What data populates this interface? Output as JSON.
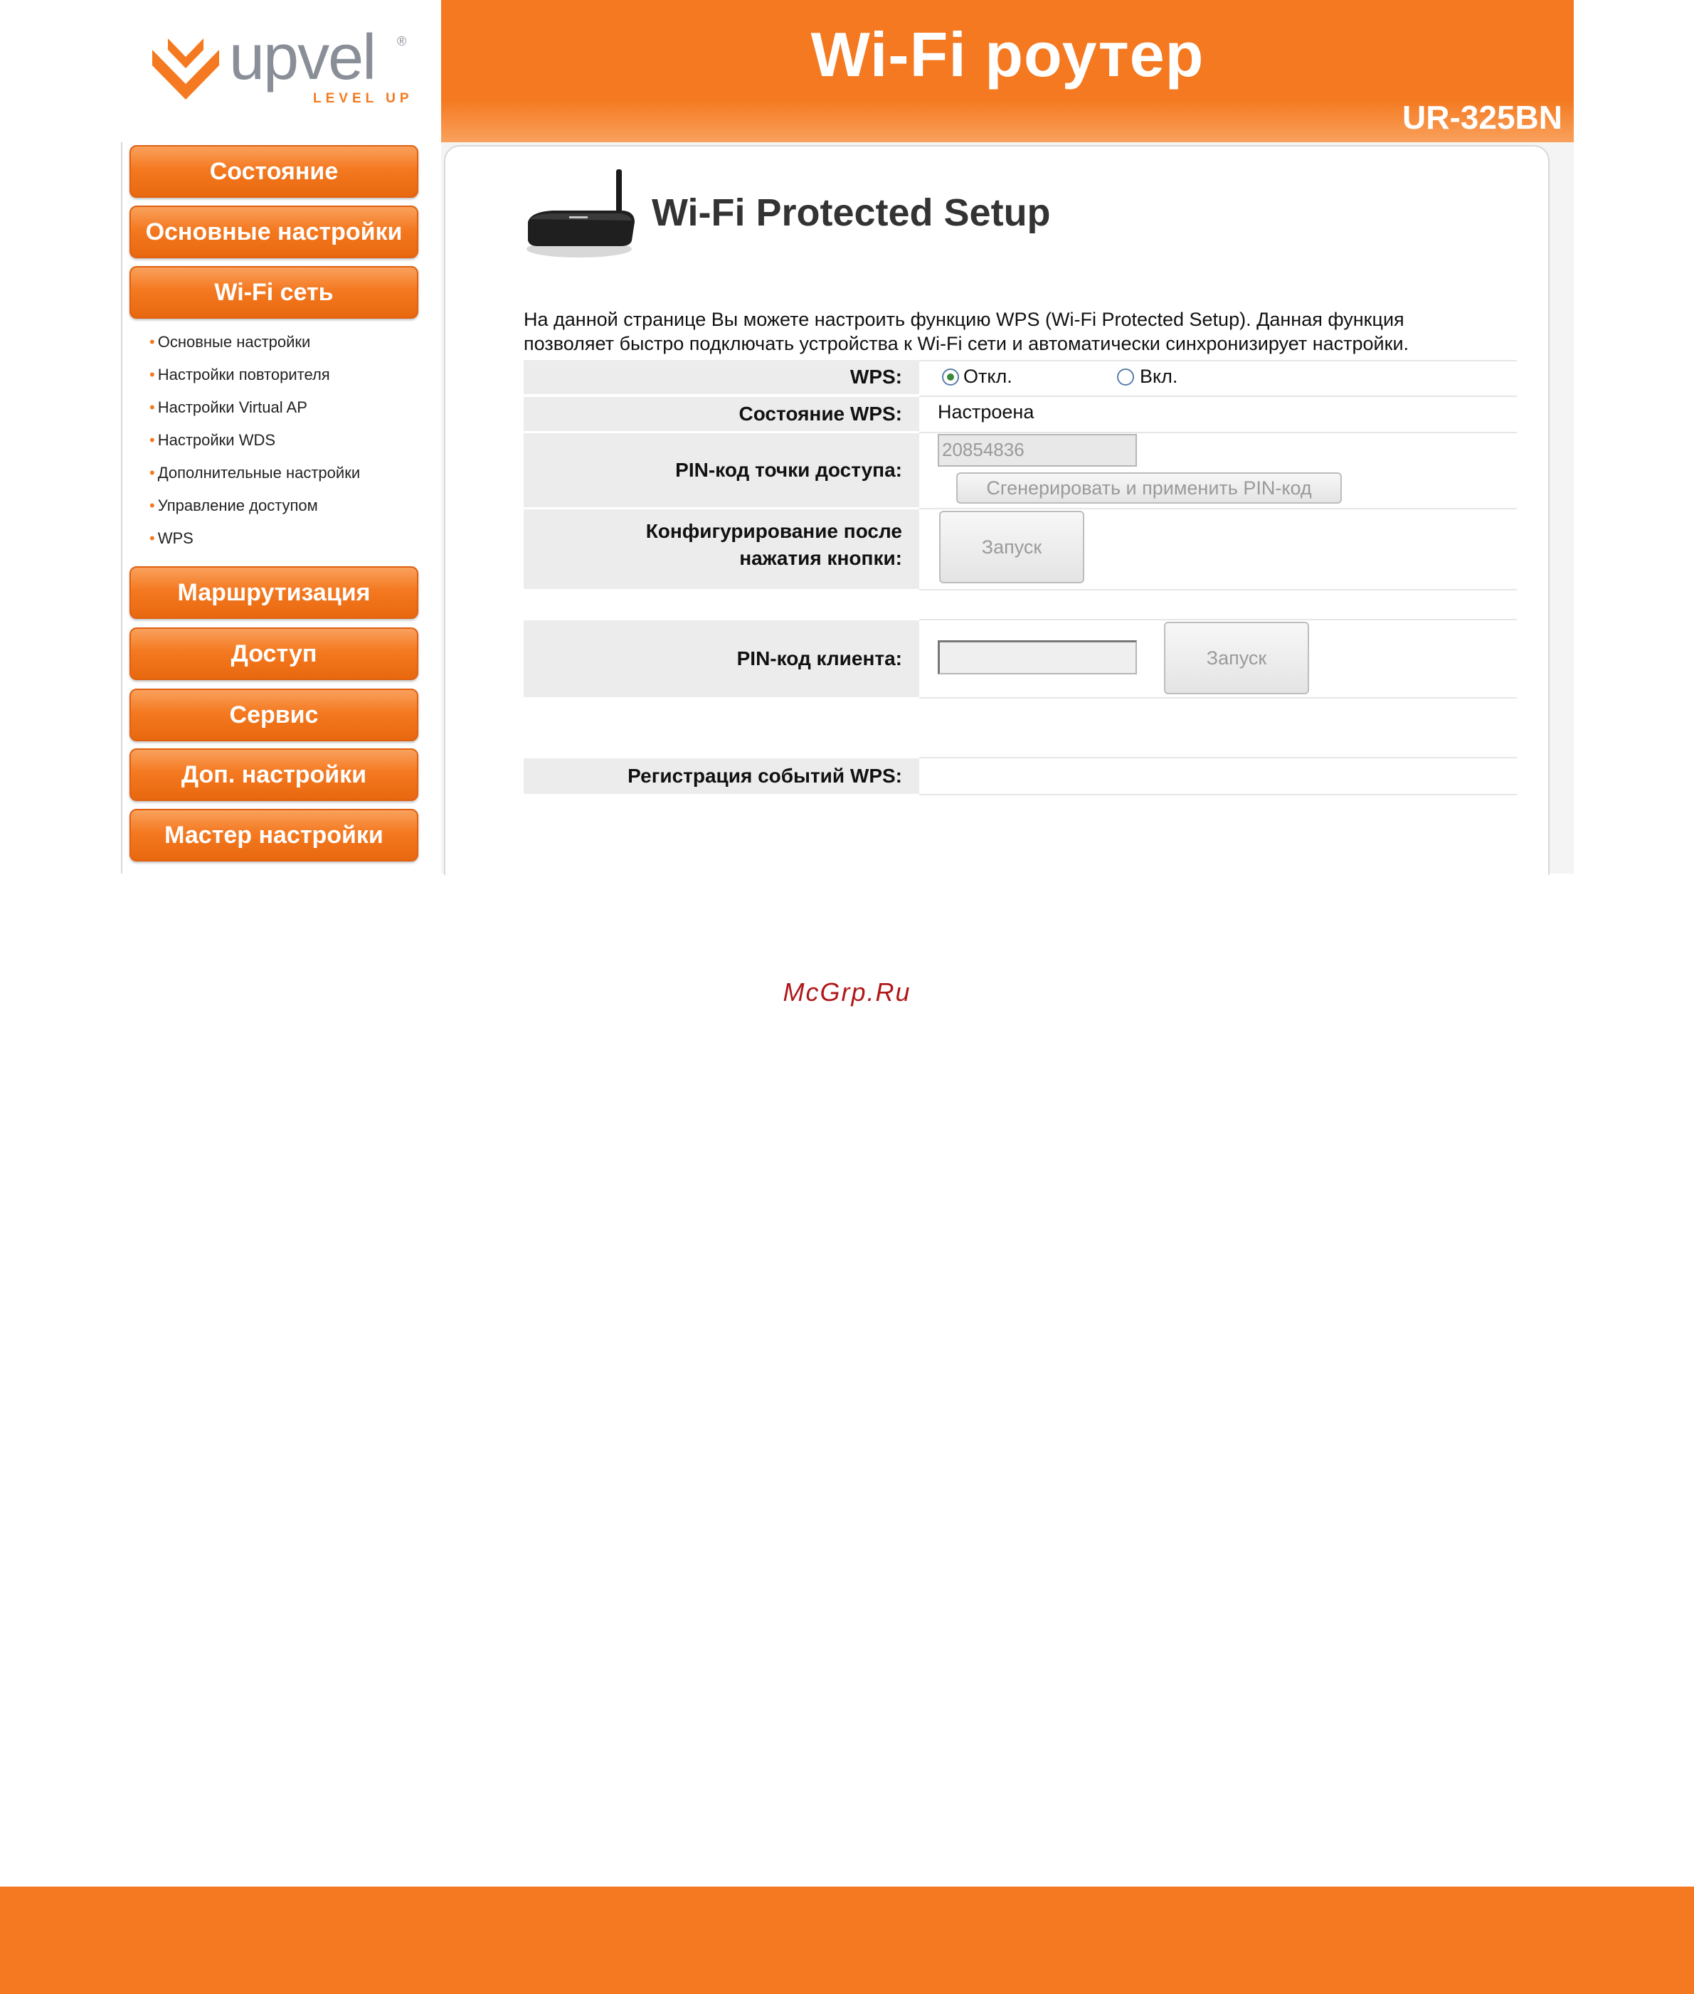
{
  "header": {
    "logo_text": "upvel",
    "logo_tagline": "LEVEL UP",
    "title": "Wi-Fi роутер",
    "model": "UR-325BN"
  },
  "sidebar": {
    "menu": [
      {
        "label": "Состояние"
      },
      {
        "label": "Основные настройки"
      },
      {
        "label": "Wi-Fi сеть"
      },
      {
        "label": "Маршрутизация"
      },
      {
        "label": "Доступ"
      },
      {
        "label": "Сервис"
      },
      {
        "label": "Доп. настройки"
      },
      {
        "label": "Мастер настройки"
      }
    ],
    "wifi_submenu": [
      "Основные настройки",
      "Настройки повторителя",
      "Настройки Virtual AP",
      "Настройки WDS",
      "Дополнительные настройки",
      "Управление доступом",
      "WPS"
    ]
  },
  "main": {
    "title": "Wi-Fi Protected Setup",
    "description_line1": "На данной странице Вы можете настроить функцию WPS (Wi-Fi Protected Setup). Данная функция",
    "description_line2": "позволяет быстро подключать устройства к Wi-Fi сети и автоматически синхронизирует настройки.",
    "wps_label": "WPS:",
    "wps_off": "Откл.",
    "wps_on": "Вкл.",
    "wps_selected": "off",
    "status_label": "Состояние WPS:",
    "status_value": "Настроена",
    "ap_pin_label": "PIN-код точки доступа:",
    "ap_pin_value": "20854836",
    "generate_pin_button": "Сгенерировать и применить PIN-код",
    "push_button_label_line1": "Конфигурирование после",
    "push_button_label_line2": "нажатия кнопки:",
    "start_button": "Запуск",
    "client_pin_label": "PIN-код клиента:",
    "client_pin_value": "",
    "client_start_button": "Запуск",
    "event_log_label": "Регистрация событий WPS:"
  },
  "watermark": "McGrp.Ru",
  "colors": {
    "accent": "#f47920",
    "watermark": "#b01818"
  }
}
